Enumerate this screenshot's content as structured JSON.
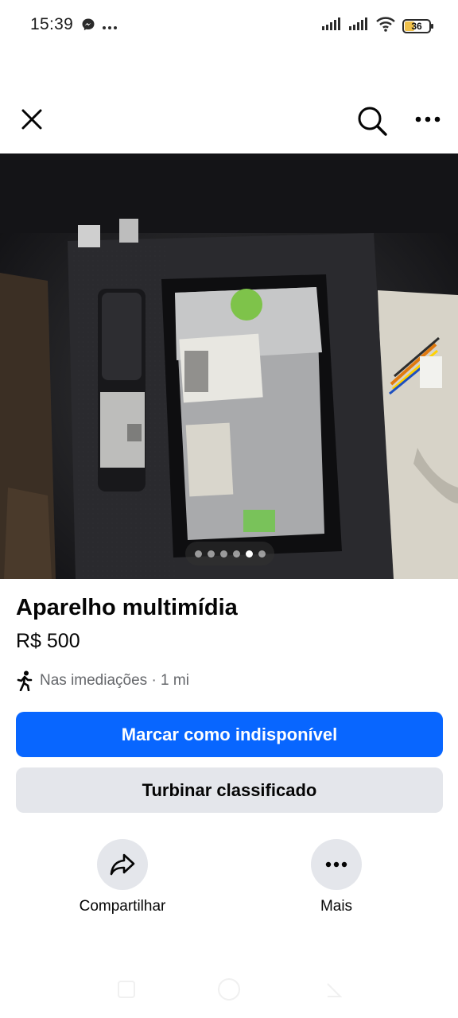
{
  "status_bar": {
    "time": "15:39",
    "battery_level": "36",
    "icons": [
      "messenger-icon",
      "more-dots-icon",
      "signal-icon",
      "signal-icon",
      "wifi-icon",
      "battery-icon"
    ]
  },
  "top_nav": {
    "icons": [
      "close-icon",
      "search-icon",
      "more-icon"
    ]
  },
  "photo": {
    "page_count": 6,
    "active_index": 4
  },
  "listing": {
    "title": "Aparelho multimídia",
    "price": "R$ 500",
    "location": "Nas imediações · 1 mi"
  },
  "buttons": {
    "mark_unavailable": "Marcar como indisponível",
    "boost": "Turbinar classificado"
  },
  "actions": {
    "share_label": "Compartilhar",
    "more_label": "Mais"
  },
  "colors": {
    "primary": "#0866ff",
    "secondary_bg": "#e4e6eb",
    "muted_text": "#65676b"
  }
}
